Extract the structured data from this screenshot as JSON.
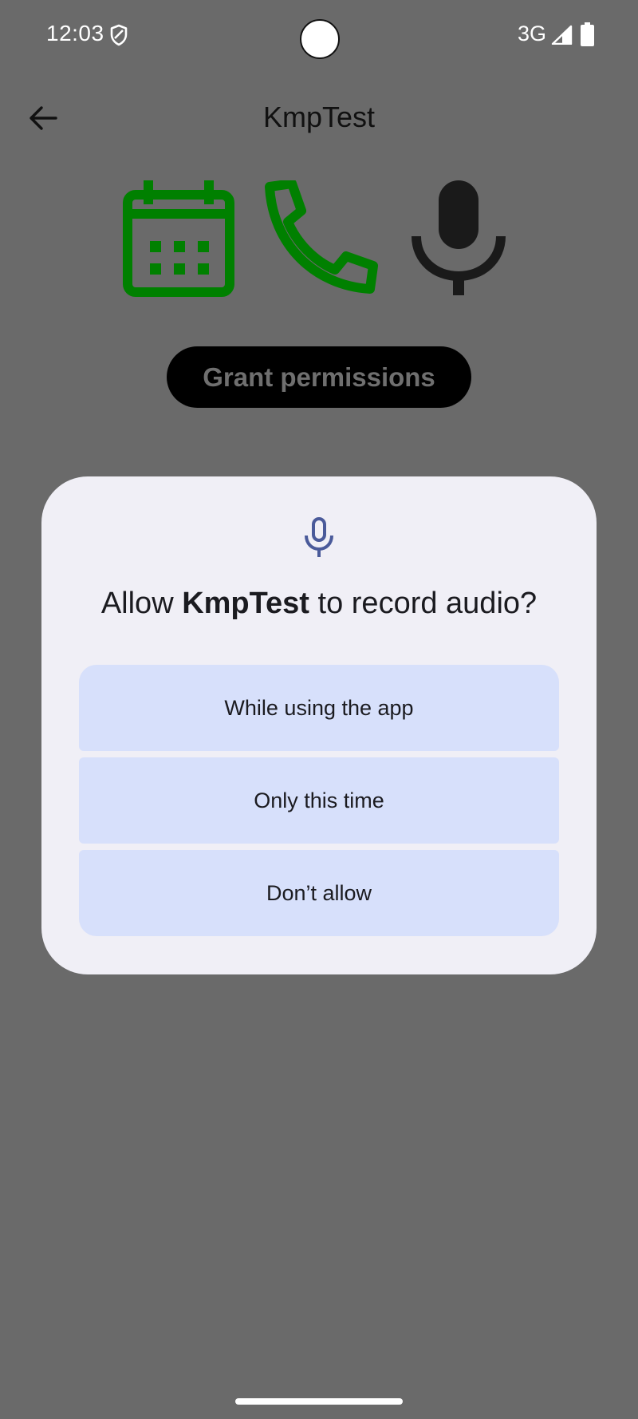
{
  "status_bar": {
    "time": "12:03",
    "network": "3G",
    "icons": [
      "shield-icon",
      "signal-icon",
      "battery-icon"
    ]
  },
  "app_bar": {
    "title": "KmpTest",
    "back_icon": "arrow-left-icon"
  },
  "permission_icons": [
    {
      "name": "calendar-icon",
      "color": "#008000"
    },
    {
      "name": "phone-icon",
      "color": "#008000"
    },
    {
      "name": "microphone-icon",
      "color": "#1a1a1a"
    }
  ],
  "grant_button": {
    "label": "Grant permissions"
  },
  "dialog": {
    "icon": "microphone-icon",
    "title_prefix": "Allow ",
    "title_app": "KmpTest",
    "title_suffix": " to record audio?",
    "options": [
      {
        "label": "While using the app"
      },
      {
        "label": "Only this time"
      },
      {
        "label": "Don’t allow"
      }
    ]
  },
  "colors": {
    "scrim_background": "#6a6a6a",
    "dialog_background": "#f0eff6",
    "option_background": "#d7e0fb",
    "dialog_icon": "#4a5a9a",
    "granted_green": "#008000"
  }
}
